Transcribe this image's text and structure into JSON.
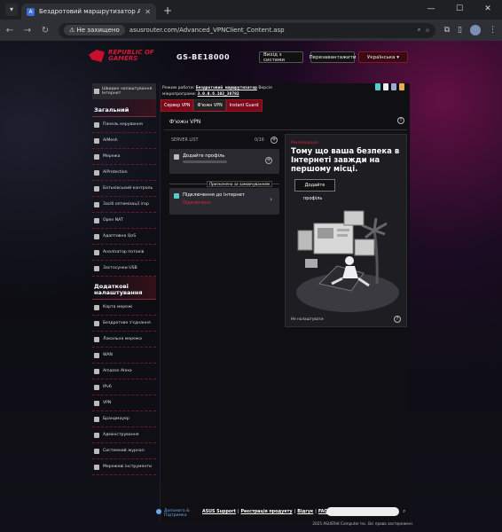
{
  "browser": {
    "tab_title": "Бездротовий маршрутизатор A",
    "security_label": "Не захищено",
    "url": "asusrouter.com/Advanced_VPNClient_Content.asp"
  },
  "header": {
    "brand": "REPUBLIC OF GAMERS",
    "model": "GS-BE18000",
    "logout_label": "Вихід з системи",
    "reboot_label": "Перезавантажити",
    "language": "Українська"
  },
  "status": {
    "mode_label": "Режим роботи:",
    "mode_value": "Бездротовий маршрутизатор",
    "version_label": "Версія",
    "firmware_label": "мікропрограми:",
    "firmware_value": "3.0.0.6.102_38782"
  },
  "sidebar": {
    "top_item": "Швидке налаштування Інтернет",
    "general_heading": "Загальний",
    "general_items": [
      "Панель керування",
      "AiMesh",
      "Мережа",
      "AiProtection",
      "Батьківський контроль",
      "Засіб оптимізації ігор",
      "Open NAT",
      "Адаптивна QoS",
      "Аналізатор потоків",
      "Застосунки USB"
    ],
    "advanced_heading": "Додаткові налаштування",
    "advanced_items": [
      "Карта мережі",
      "Бездротове з'єднання",
      "Локальна мережа",
      "WAN",
      "Amazon Alexa",
      "IPv6",
      "VPN",
      "Брандмауер",
      "Адміністрування",
      "Системний журнал",
      "Мережеві інструменти"
    ]
  },
  "vpn_tabs": [
    "Сервер VPN",
    "Ф'южн VPN",
    "Instant Guard"
  ],
  "page": {
    "title": "Ф'южн VPN",
    "server_list_label": "SERVER LIST",
    "server_count": "0/16",
    "add_profile": "Додайте профіль",
    "default_badge": "Призначено за замовчуванням",
    "internet_connection": "Підключення до Інтернет",
    "internet_status": "Підключено"
  },
  "promo": {
    "tag": "Рекомендація",
    "headline": "Тому що ваша безпека в Інтернеті завжди на першому місці.",
    "button": "Додайте",
    "sub": "профіль",
    "footer": "Не налаштувати"
  },
  "footer": {
    "help": "Допомога & Підтримка",
    "links": [
      "ASUS Support",
      "Реєстрація продукту",
      "Відгук",
      "FAQ"
    ],
    "copyright": "2025 ASUSTeK Computer Inc. Всі права застережені."
  },
  "colors": {
    "accent_red": "#c8102e",
    "status_red": "#e0253a"
  }
}
